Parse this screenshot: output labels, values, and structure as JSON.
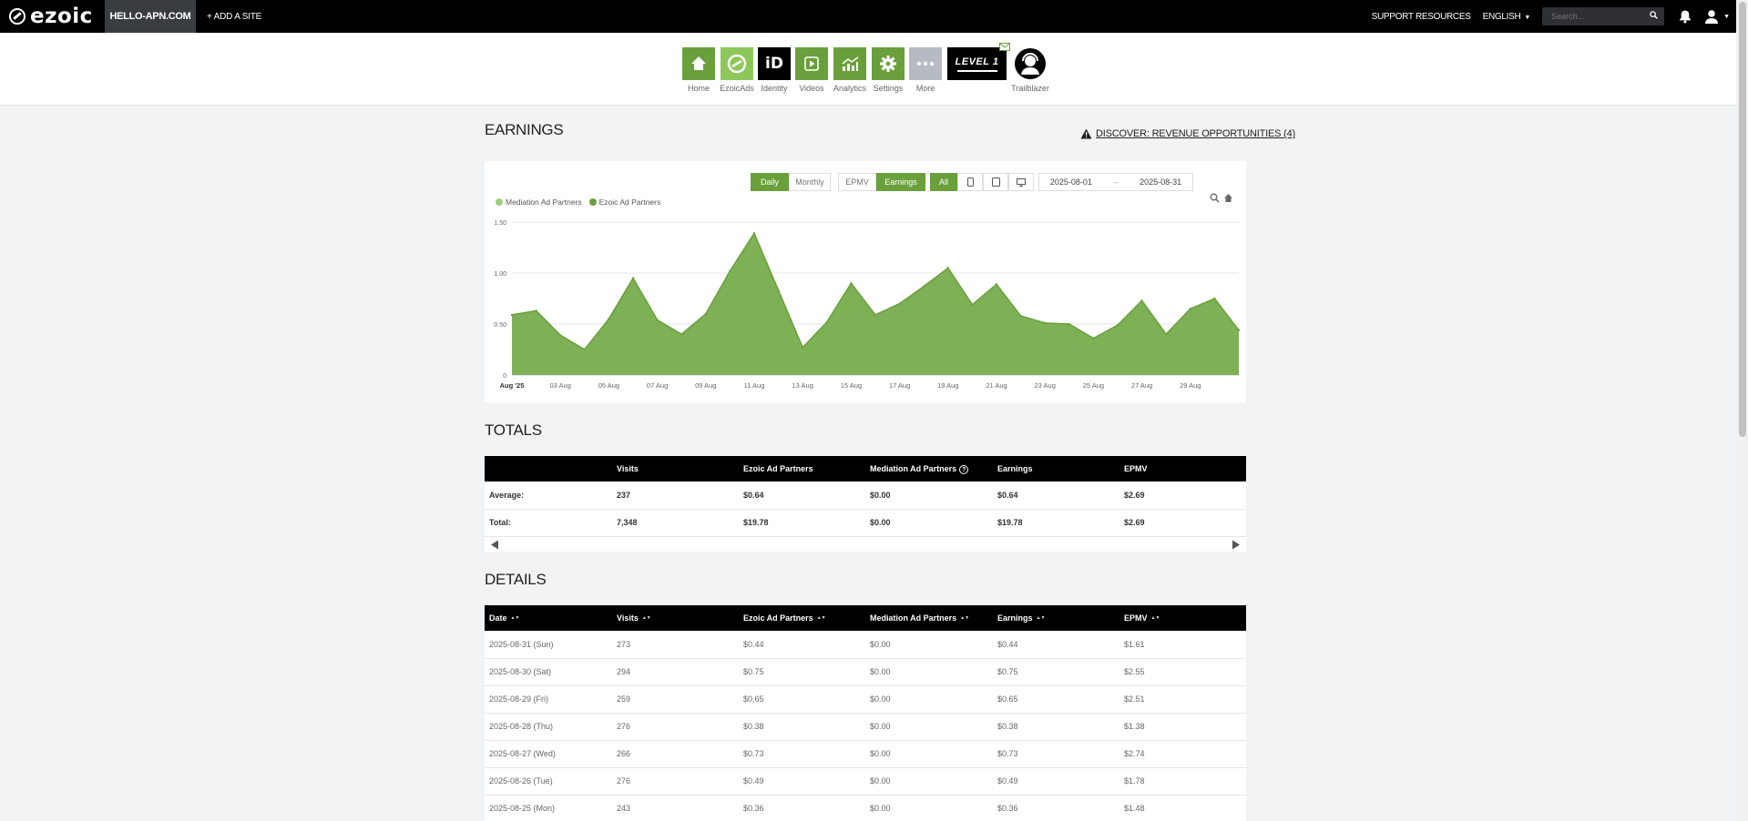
{
  "topbar": {
    "logo": "ezoic",
    "site": "HELLO-APN.COM",
    "add_site": "+ ADD A SITE",
    "support": "SUPPORT RESOURCES",
    "language": "ENGLISH",
    "search_placeholder": "Search..."
  },
  "nav": [
    {
      "label": "Home",
      "icon": "home-icon"
    },
    {
      "label": "EzoicAds",
      "icon": "ezoicads-icon"
    },
    {
      "label": "Identity",
      "icon": "identity-icon"
    },
    {
      "label": "Videos",
      "icon": "videos-icon"
    },
    {
      "label": "Analytics",
      "icon": "analytics-icon"
    },
    {
      "label": "Settings",
      "icon": "gear-icon"
    },
    {
      "label": "More",
      "icon": "more-icon"
    },
    {
      "label": "LEVEL 1",
      "icon": "level-badge"
    },
    {
      "label": "Trailblazer",
      "icon": "trailblazer-icon"
    }
  ],
  "identity_badge": "iD",
  "earnings": {
    "title": "EARNINGS",
    "discover": "DISCOVER: REVENUE OPPORTUNITIES (4)",
    "btn_daily": "Daily",
    "btn_monthly": "Monthly",
    "btn_epmv": "EPMV",
    "btn_earnings": "Earnings",
    "btn_all": "All",
    "date_from": "2025-08-01",
    "date_sep": "–",
    "date_to": "2025-08-31"
  },
  "colors": {
    "accent": "#6aa03c",
    "area": "#7eb055",
    "mediation": "#9ecf7a"
  },
  "chart_data": {
    "type": "area",
    "legend": [
      "Mediation Ad Partners",
      "Ezoic Ad Partners"
    ],
    "x_ticks": [
      "Aug '25",
      "03 Aug",
      "05 Aug",
      "07 Aug",
      "09 Aug",
      "11 Aug",
      "13 Aug",
      "15 Aug",
      "17 Aug",
      "19 Aug",
      "21 Aug",
      "23 Aug",
      "25 Aug",
      "27 Aug",
      "29 Aug"
    ],
    "y_ticks": [
      "0",
      "0.50",
      "1.00",
      "1.50"
    ],
    "ylim": [
      0,
      1.5
    ],
    "series": [
      {
        "name": "Ezoic Ad Partners",
        "values": [
          0.59,
          0.63,
          0.39,
          0.25,
          0.55,
          0.95,
          0.54,
          0.4,
          0.6,
          1.02,
          1.39,
          0.83,
          0.27,
          0.52,
          0.9,
          0.59,
          0.7,
          0.87,
          1.05,
          0.69,
          0.89,
          0.58,
          0.51,
          0.5,
          0.36,
          0.49,
          0.73,
          0.4,
          0.65,
          0.75,
          0.44
        ]
      }
    ]
  },
  "totals": {
    "title": "TOTALS",
    "headers": [
      "",
      "Visits",
      "Ezoic Ad Partners",
      "Mediation Ad Partners",
      "Earnings",
      "EPMV"
    ],
    "rows": [
      [
        "Average:",
        "237",
        "$0.64",
        "$0.00",
        "$0.64",
        "$2.69"
      ],
      [
        "Total:",
        "7,348",
        "$19.78",
        "$0.00",
        "$19.78",
        "$2.69"
      ]
    ]
  },
  "details": {
    "title": "DETAILS",
    "headers": [
      "Date",
      "Visits",
      "Ezoic Ad Partners",
      "Mediation Ad Partners",
      "Earnings",
      "EPMV"
    ],
    "rows": [
      [
        "2025-08-31 (Sun)",
        "273",
        "$0.44",
        "$0.00",
        "$0.44",
        "$1.61"
      ],
      [
        "2025-08-30 (Sat)",
        "294",
        "$0.75",
        "$0.00",
        "$0.75",
        "$2.55"
      ],
      [
        "2025-08-29 (Fri)",
        "259",
        "$0.65",
        "$0.00",
        "$0.65",
        "$2.51"
      ],
      [
        "2025-08-28 (Thu)",
        "276",
        "$0.38",
        "$0.00",
        "$0.38",
        "$1.38"
      ],
      [
        "2025-08-27 (Wed)",
        "266",
        "$0.73",
        "$0.00",
        "$0.73",
        "$2.74"
      ],
      [
        "2025-08-26 (Tue)",
        "276",
        "$0.49",
        "$0.00",
        "$0.49",
        "$1.78"
      ],
      [
        "2025-08-25 (Mon)",
        "243",
        "$0.36",
        "$0.00",
        "$0.36",
        "$1.48"
      ]
    ]
  }
}
